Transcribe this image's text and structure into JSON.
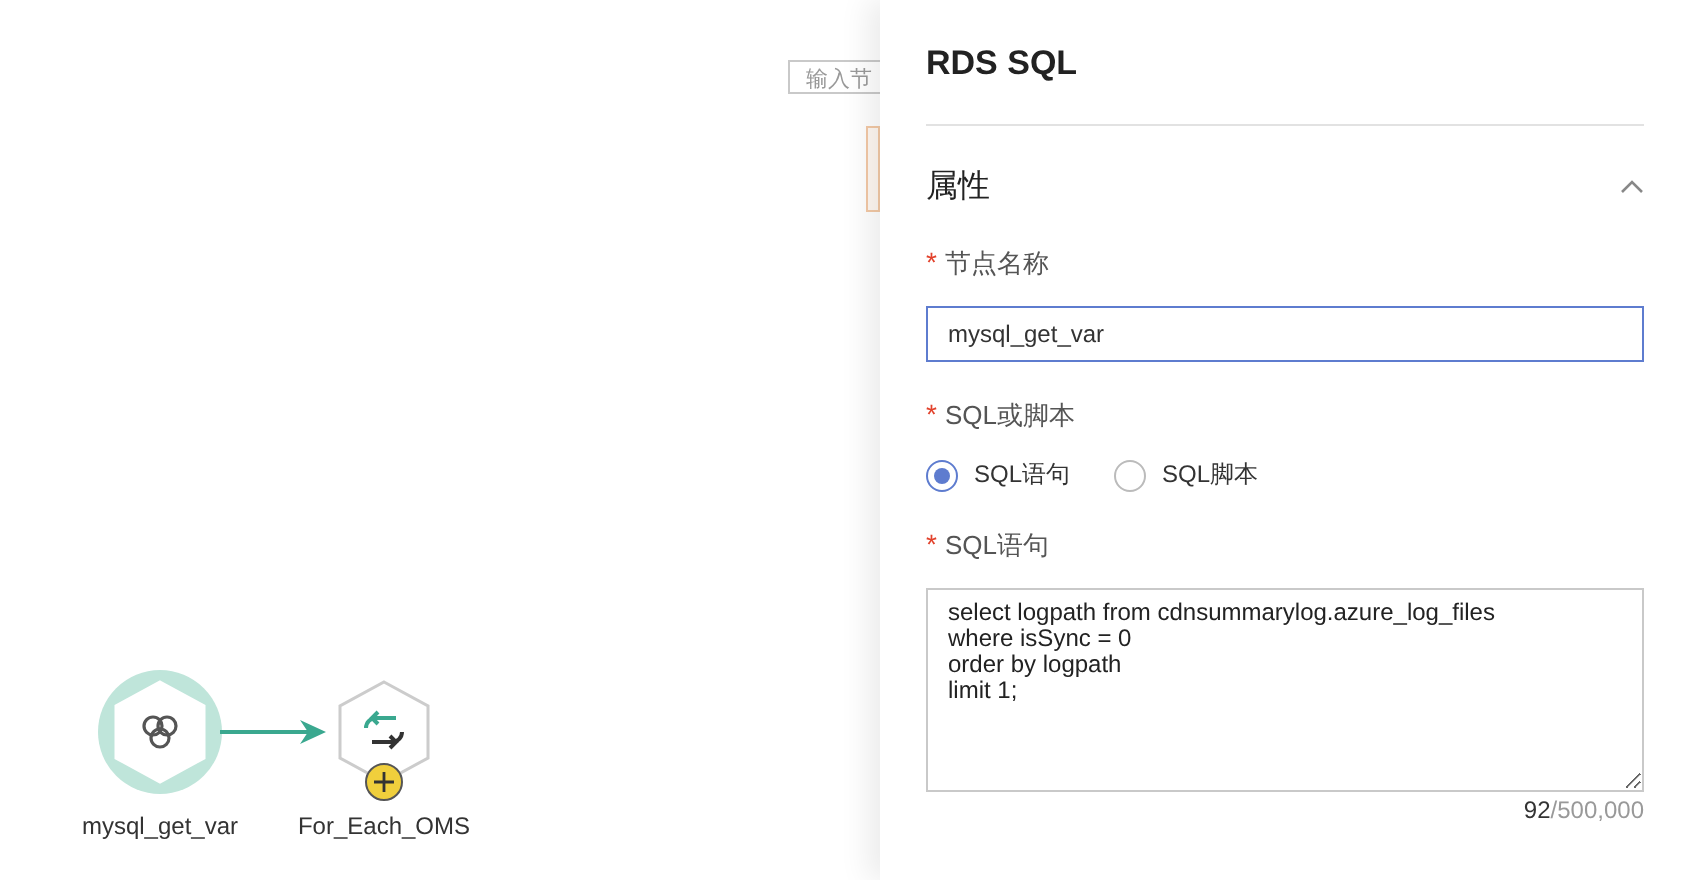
{
  "canvas": {
    "search": {
      "placeholder": "输入节"
    },
    "nodes": [
      {
        "label": "mysql_get_var",
        "kind": "sql",
        "selected": true
      },
      {
        "label": "For_Each_OMS",
        "kind": "loop",
        "selected": false
      }
    ]
  },
  "panel": {
    "title": "RDS SQL",
    "section": {
      "title": "属性",
      "expanded": true
    },
    "fields": [
      {
        "kind": "text",
        "label": "节点名称",
        "marker": "*",
        "value": "mysql_get_var"
      },
      {
        "kind": "radio",
        "label": "SQL或脚本",
        "marker": "*",
        "options": [
          {
            "label": "SQL语句",
            "selected": true
          },
          {
            "label": "SQL脚本",
            "selected": false
          }
        ]
      },
      {
        "kind": "textarea",
        "label": "SQL语句",
        "marker": "*",
        "value": "select logpath from cdnsummarylog.azure_log_files\nwhere isSync = 0\norder by logpath\nlimit 1;",
        "count": "92",
        "limit": "/500,000"
      }
    ]
  }
}
